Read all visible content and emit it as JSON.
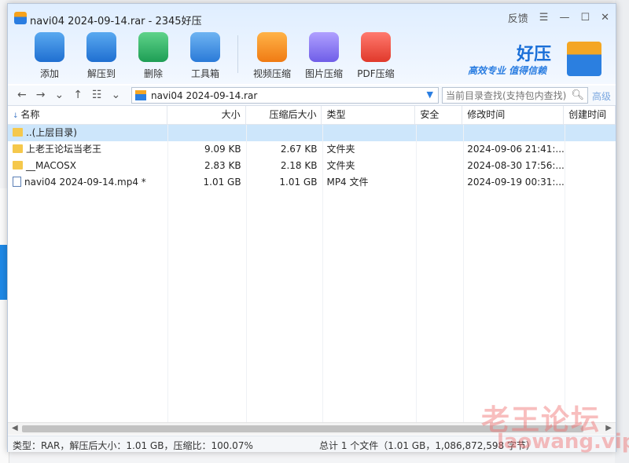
{
  "window": {
    "title": "navi04 2024-09-14.rar - 2345好压",
    "feedback_label": "反馈",
    "menu_icon": "hamburger-icon",
    "minimize_icon": "minimize-icon",
    "maximize_icon": "maximize-icon",
    "close_icon": "close-icon"
  },
  "toolbar": {
    "items": [
      {
        "label": "添加",
        "icon": "add-archive-icon",
        "color": "#2e86de"
      },
      {
        "label": "解压到",
        "icon": "extract-icon",
        "color": "#2e86de"
      },
      {
        "label": "删除",
        "icon": "recycle-icon",
        "color": "#27ae60"
      },
      {
        "label": "工具箱",
        "icon": "toolbox-icon",
        "color": "#2e86de"
      },
      {
        "label": "视频压缩",
        "icon": "video-compress-icon",
        "color": "#f39c12"
      },
      {
        "label": "图片压缩",
        "icon": "image-compress-icon",
        "color": "#8e7cf0"
      },
      {
        "label": "PDF压缩",
        "icon": "pdf-compress-icon",
        "color": "#e74c3c"
      }
    ]
  },
  "brand": {
    "name": "好压",
    "slogan": "高效专业  值得信赖"
  },
  "address": {
    "path": "navi04 2024-09-14.rar",
    "search_placeholder": "当前目录查找(支持包内查找)",
    "advanced_label": "高级"
  },
  "columns": [
    "名称",
    "大小",
    "压缩后大小",
    "类型",
    "安全",
    "修改时间",
    "创建时间"
  ],
  "rows": [
    {
      "name": "..(上层目录)",
      "size": "",
      "csize": "",
      "type": "",
      "sec": "",
      "mtime": "",
      "ctime": "",
      "kind": "folder",
      "selected": true
    },
    {
      "name": "上老王论坛当老王",
      "size": "9.09 KB",
      "csize": "2.67 KB",
      "type": "文件夹",
      "sec": "",
      "mtime": "2024-09-06 21:41:...",
      "ctime": "",
      "kind": "folder",
      "selected": false
    },
    {
      "name": "__MACOSX",
      "size": "2.83 KB",
      "csize": "2.18 KB",
      "type": "文件夹",
      "sec": "",
      "mtime": "2024-08-30 17:56:...",
      "ctime": "",
      "kind": "folder",
      "selected": false
    },
    {
      "name": "navi04 2024-09-14.mp4 *",
      "size": "1.01 GB",
      "csize": "1.01 GB",
      "type": "MP4 文件",
      "sec": "",
      "mtime": "2024-09-19 00:31:...",
      "ctime": "",
      "kind": "file",
      "selected": false
    }
  ],
  "status": {
    "left": "类型：RAR，解压后大小：1.01 GB，压缩比：100.07%",
    "right": "总计 1 个文件（1.01 GB，1,086,872,598 字节）"
  },
  "watermark": {
    "line1": "老王论坛",
    "line2": "laowang.vip"
  }
}
